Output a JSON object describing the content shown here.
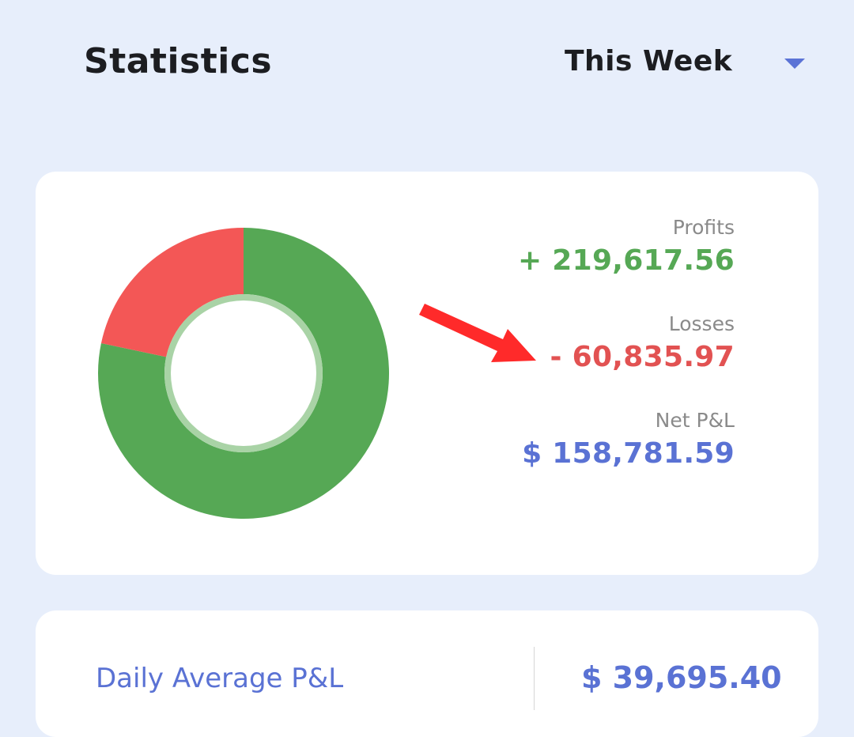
{
  "header": {
    "title": "Statistics",
    "period": "This Week"
  },
  "summary": {
    "profits_label": "Profits",
    "profits_value": "+ 219,617.56",
    "losses_label": "Losses",
    "losses_value": "- 60,835.97",
    "net_label": "Net P&L",
    "net_value": "$ 158,781.59"
  },
  "chart_data": {
    "type": "pie",
    "donut": true,
    "categories": [
      "Profits",
      "Losses"
    ],
    "values": [
      219617.56,
      60835.97
    ]
  },
  "colors": {
    "profit": "#56a855",
    "loss": "#f35756",
    "net": "#5a72d4",
    "ring_inner": "#a9d3a6",
    "annotation_arrow": "#ff2a2a"
  },
  "daily": {
    "label": "Daily Average P&L",
    "value": "$ 39,695.40"
  }
}
